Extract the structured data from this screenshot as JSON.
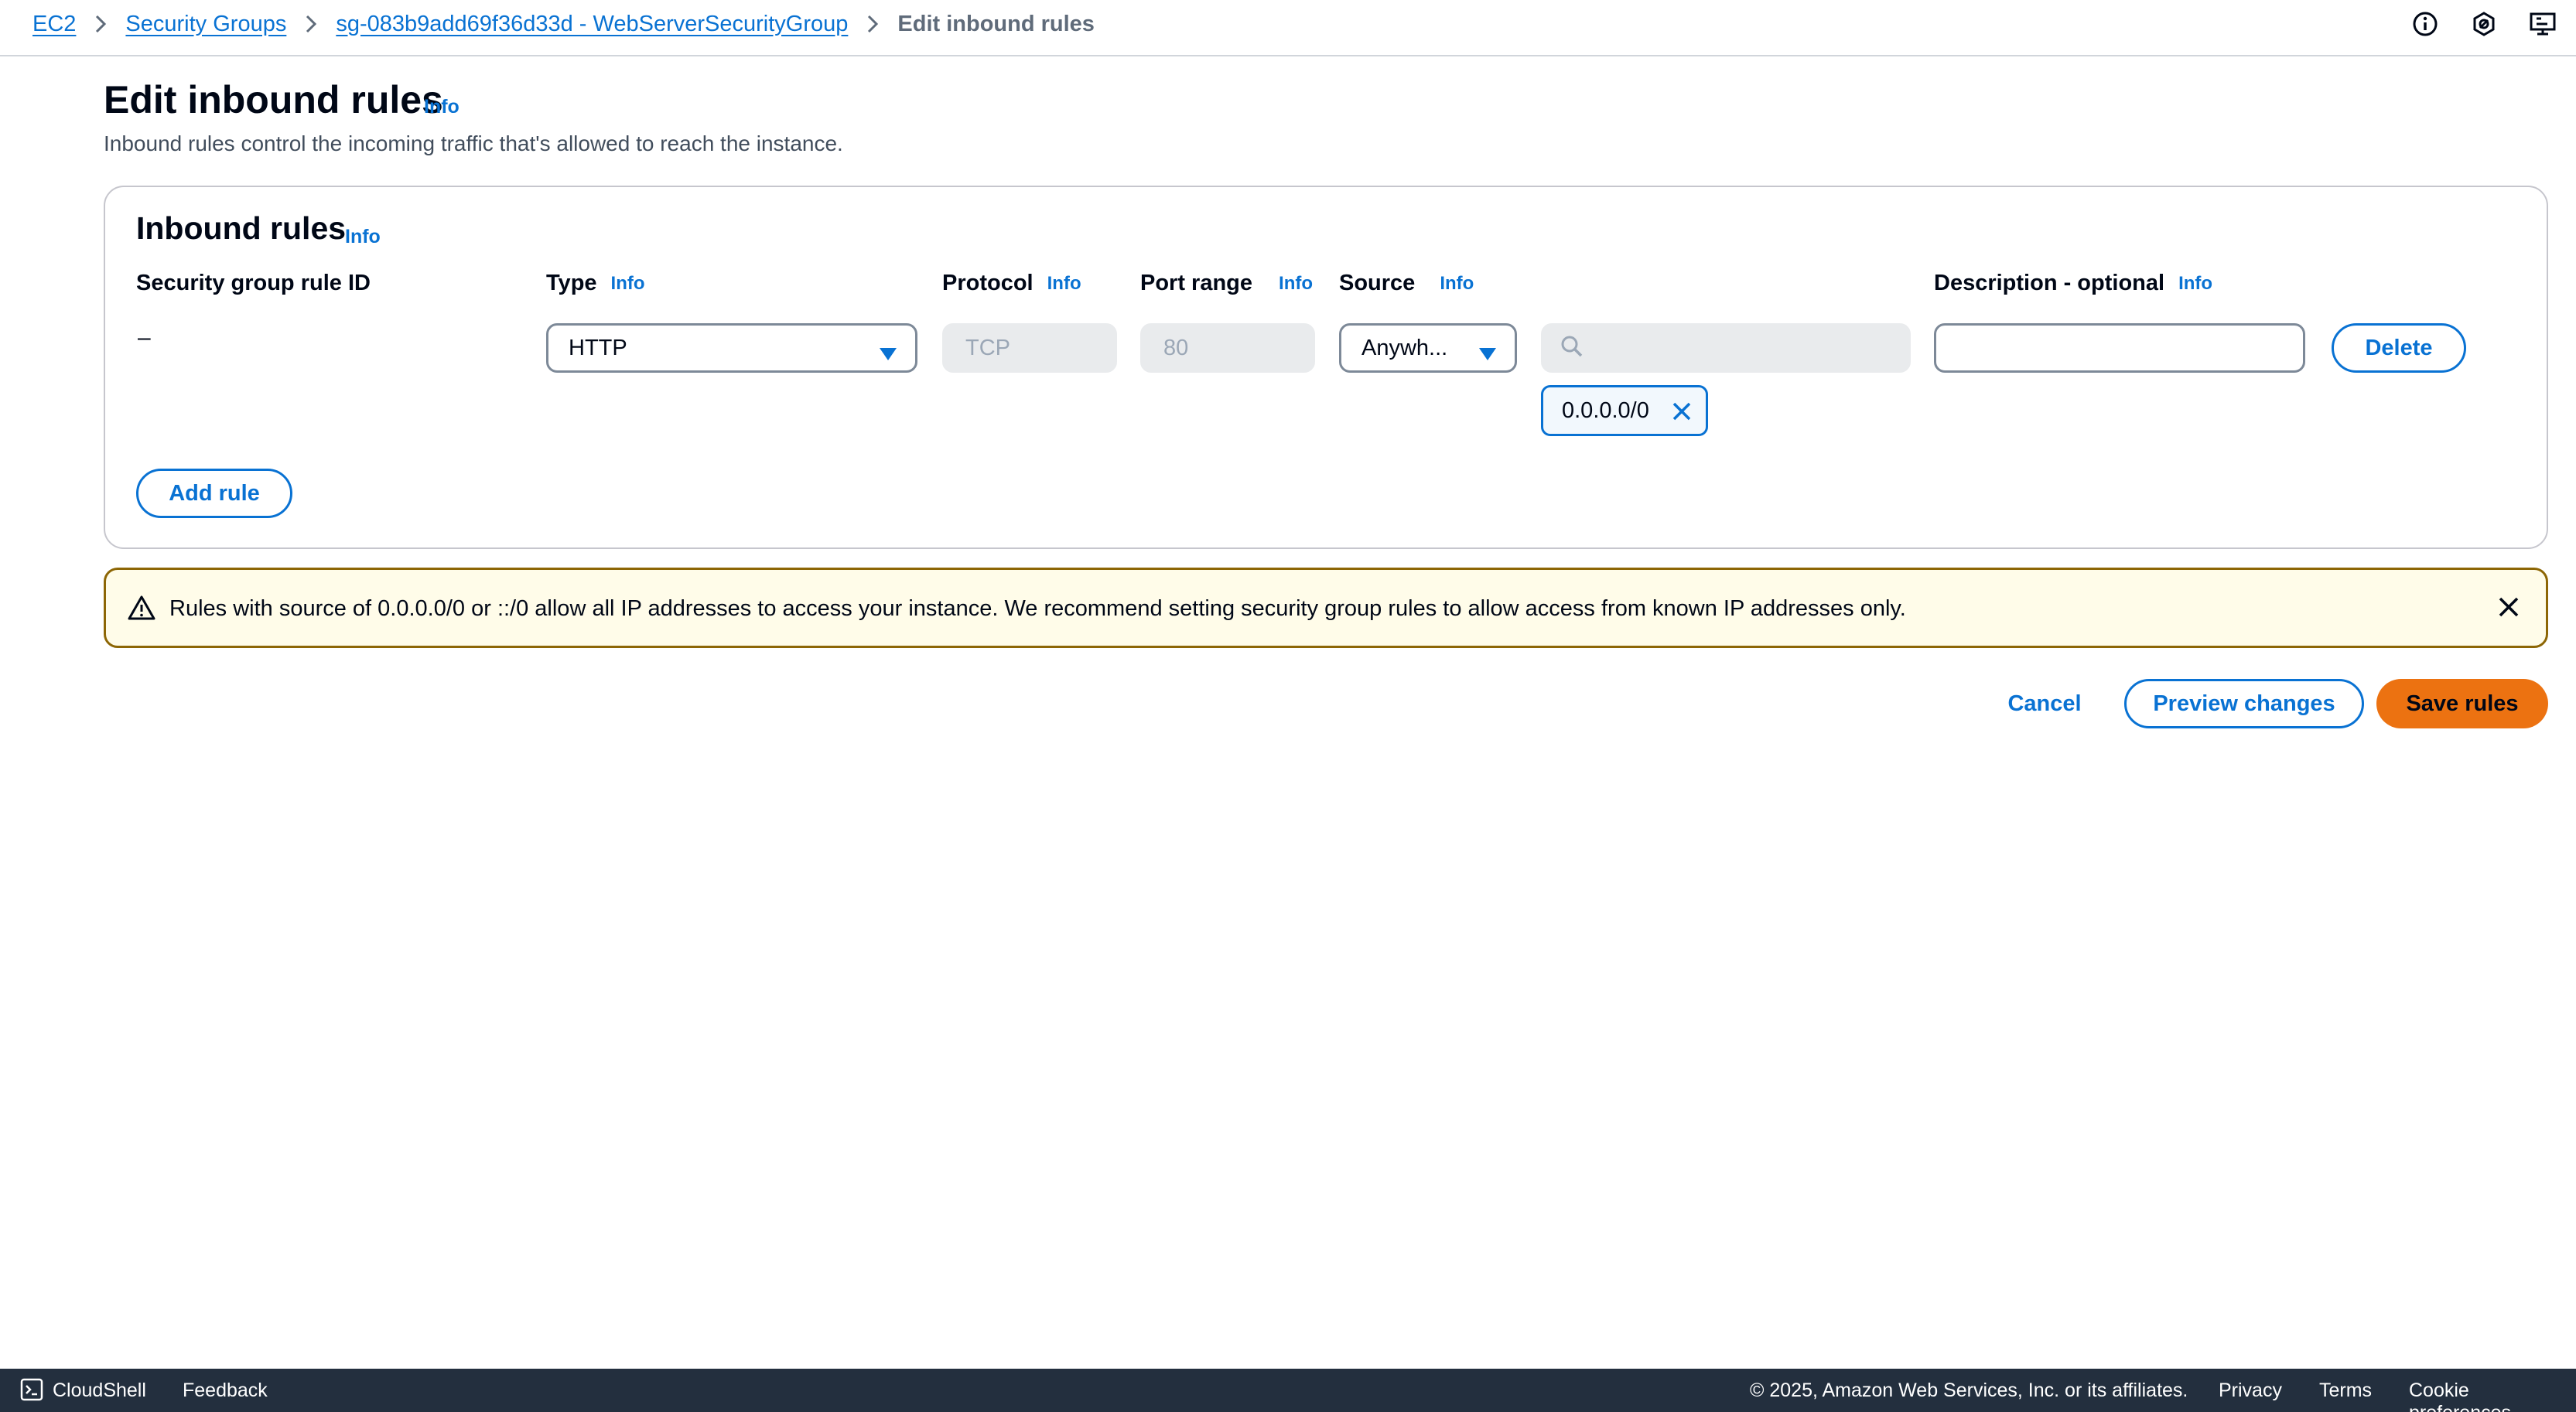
{
  "breadcrumb": {
    "items": [
      "EC2",
      "Security Groups",
      "sg-083b9add69f36d33d - WebServerSecurityGroup"
    ],
    "current": "Edit inbound rules"
  },
  "top_icons": [
    "info-circle-icon",
    "notifications-icon",
    "settings-icon"
  ],
  "header": {
    "title": "Edit inbound rules",
    "info": "Info",
    "description": "Inbound rules control the incoming traffic that's allowed to reach the instance."
  },
  "inbound_rules": {
    "title": "Inbound rules",
    "info": "Info",
    "columns": {
      "rule_id": "Security group rule ID",
      "type": "Type",
      "protocol": "Protocol",
      "port_range": "Port range",
      "source": "Source",
      "description": "Description - optional",
      "info": "Info"
    },
    "rows": [
      {
        "rule_id": "–",
        "type": "HTTP",
        "protocol": "TCP",
        "port_range": "80",
        "source": "Anywh...",
        "search_value": "",
        "cidr_token": "0.0.0.0/0",
        "description": "",
        "delete_label": "Delete"
      }
    ],
    "add_rule_label": "Add rule"
  },
  "alert": {
    "text": "Rules with source of 0.0.0.0/0 or ::/0 allow all IP addresses to access your instance. We recommend setting security group rules to allow access from known IP addresses only."
  },
  "actions": {
    "cancel": "Cancel",
    "preview": "Preview changes",
    "save": "Save rules"
  },
  "footer": {
    "cloudshell": "CloudShell",
    "feedback": "Feedback",
    "copyright": "© 2025, Amazon Web Services, Inc. or its affiliates.",
    "privacy": "Privacy",
    "terms": "Terms",
    "cookies": "Cookie preferences"
  },
  "colors": {
    "link": "#0972d3",
    "primary_button": "#ec7211",
    "alert_border": "#8d6605",
    "alert_bg": "#fffce9",
    "footer_bg": "#232f3e"
  }
}
